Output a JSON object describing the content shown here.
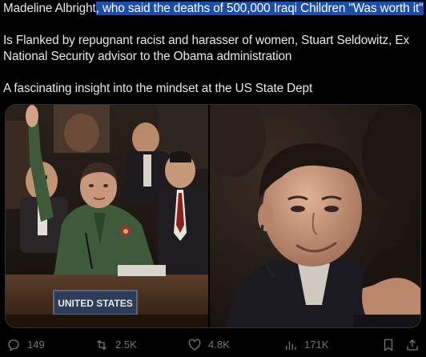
{
  "tweet": {
    "line1_prefix": "Madeline Albright",
    "line1_highlight": ", who said the deaths of 500,000 Iraqi Children \"Was worth it\"",
    "para2_line1": "Is Flanked by repugnant racist and harasser of women, Stuart Seldowitz, Ex",
    "para2_line2": "National Security advisor to the Obama administration",
    "para3": "A fascinating insight into the mindset  at the US State Dept"
  },
  "media": {
    "left_photo_sign": "UNITED STATES",
    "colors": {
      "background_dark": "#1b1612",
      "suit_green": "#3e5a3a",
      "skin": "#c9987c",
      "sign": "#2d3c57"
    }
  },
  "actions": {
    "replies": {
      "icon": "reply-icon",
      "count": "149"
    },
    "reposts": {
      "icon": "repost-icon",
      "count": "2.5K"
    },
    "likes": {
      "icon": "heart-icon",
      "count": "4.8K"
    },
    "views": {
      "icon": "views-icon",
      "count": "171K"
    },
    "bookmark": {
      "icon": "bookmark-icon"
    },
    "share": {
      "icon": "share-icon"
    }
  },
  "colors": {
    "background": "#000000",
    "text": "#e7e9ea",
    "highlight": "#1d4ea5",
    "muted": "#71767b"
  }
}
